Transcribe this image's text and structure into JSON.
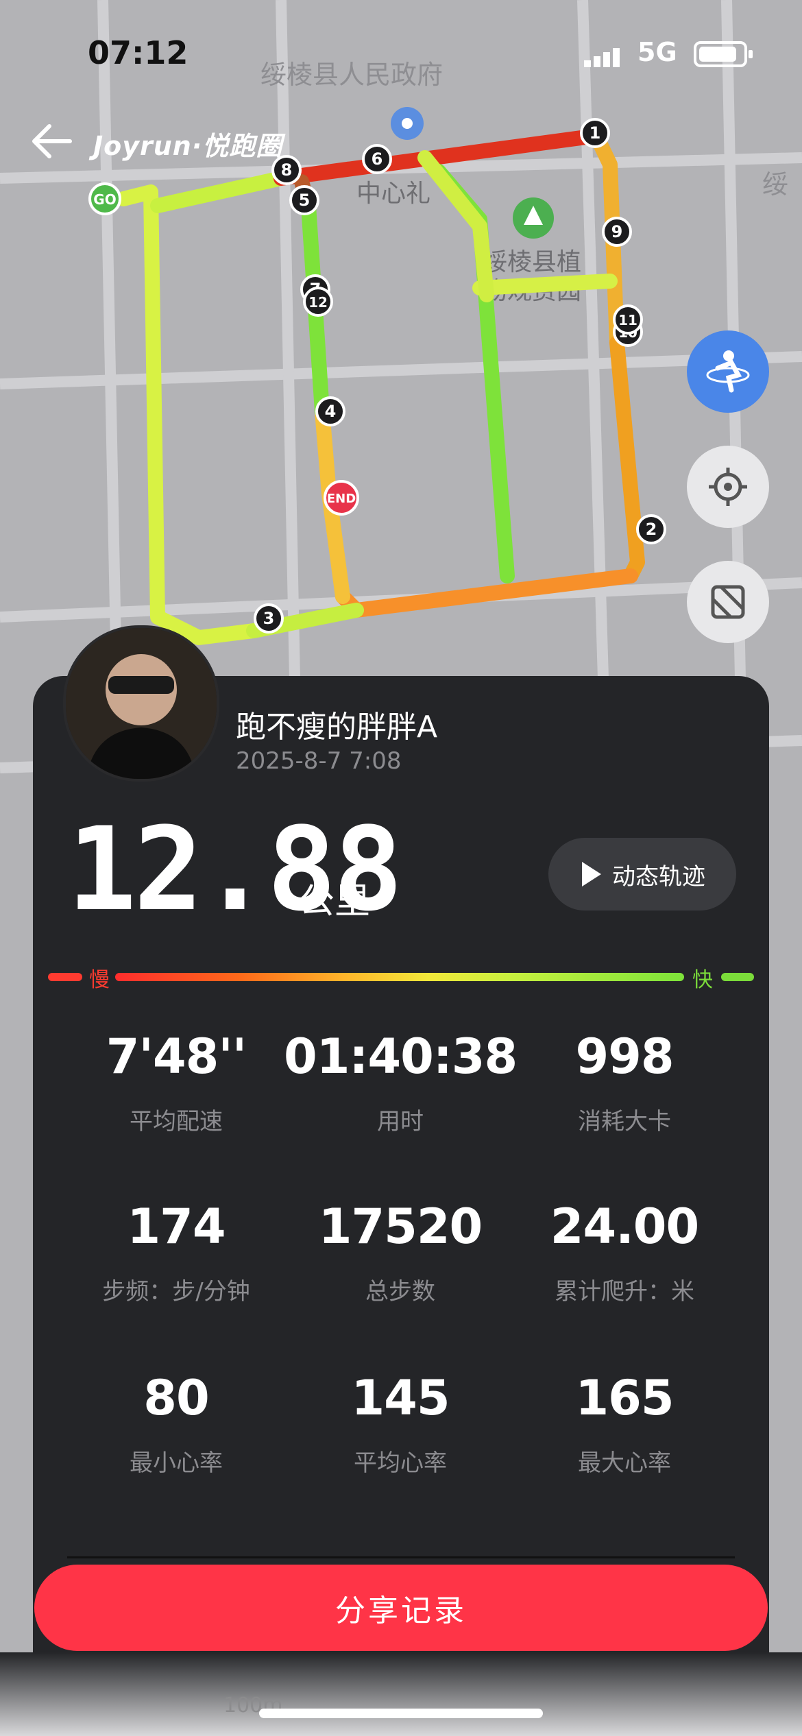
{
  "status_bar": {
    "time": "07:12",
    "network": "5G"
  },
  "header": {
    "brand": "Joyrun·悦跑圈"
  },
  "map": {
    "labels": [
      "绥棱县人民政府",
      "中心礼",
      "绥棱县植",
      "物观赏园",
      "绥"
    ],
    "start_label": "GO",
    "end_label": "END",
    "km_markers": [
      "1",
      "2",
      "3",
      "4",
      "5",
      "6",
      "7",
      "8",
      "9",
      "10",
      "11",
      "12"
    ],
    "scale_label": "100m"
  },
  "fabs": [
    "runner-icon",
    "locate-icon",
    "layers-icon"
  ],
  "profile": {
    "username": "跑不瘦的胖胖A",
    "date": "2025-8-7 7:08"
  },
  "summary": {
    "distance": "12.88",
    "unit": "公里",
    "replay_label": "动态轨迹"
  },
  "speed_legend": {
    "slow": "慢",
    "fast": "快",
    "slow_color": "#ff3b30",
    "fast_color": "#7bdc3a"
  },
  "stats": [
    {
      "value": "7'48''",
      "label": "平均配速"
    },
    {
      "value": "01:40:38",
      "label": "用时"
    },
    {
      "value": "998",
      "label": "消耗大卡"
    },
    {
      "value": "174",
      "label": "步频：步/分钟"
    },
    {
      "value": "17520",
      "label": "总步数"
    },
    {
      "value": "24.00",
      "label": "累计爬升：米"
    },
    {
      "value": "80",
      "label": "最小心率"
    },
    {
      "value": "145",
      "label": "平均心率"
    },
    {
      "value": "165",
      "label": "最大心率"
    }
  ],
  "share_label": "分享记录",
  "colors": {
    "accent": "#ff3447",
    "card": "#242528",
    "map_bg": "#b3b3b6"
  }
}
